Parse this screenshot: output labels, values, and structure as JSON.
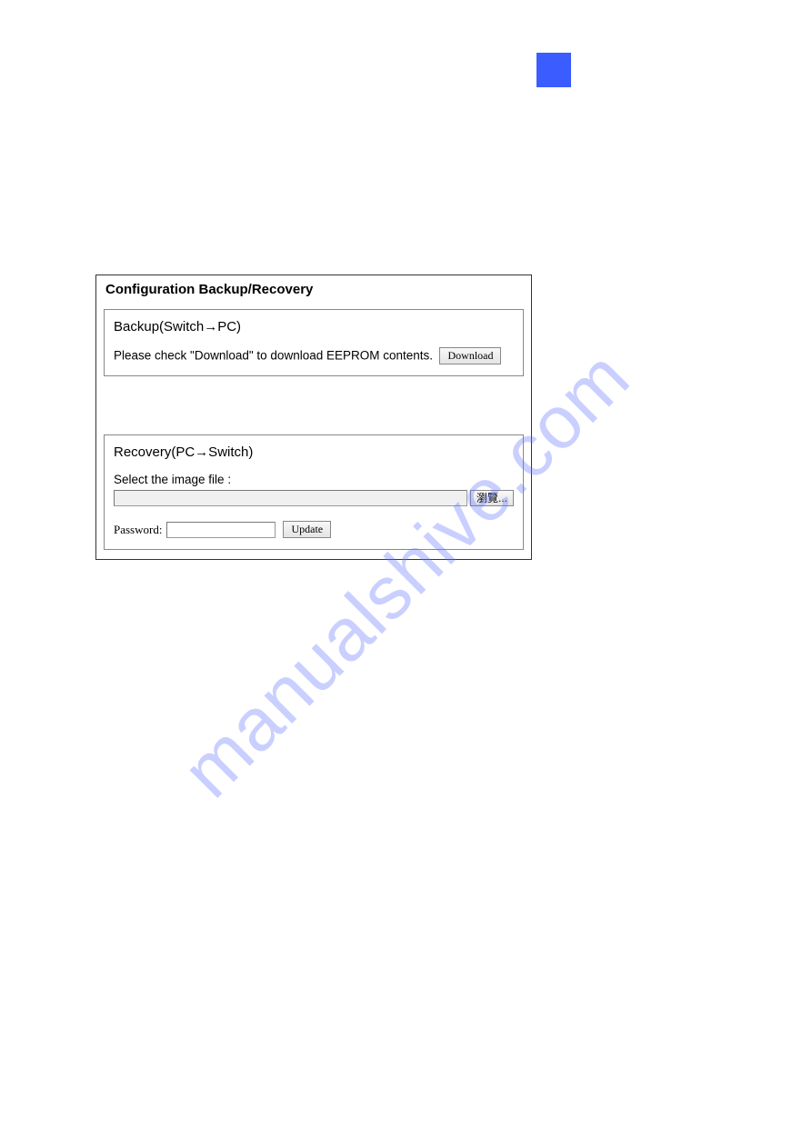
{
  "watermark": "manualshive.com",
  "panel": {
    "header": "Configuration Backup/Recovery",
    "backup": {
      "title": "Backup(Switch→PC)",
      "text": "Please check \"Download\" to download EEPROM contents.",
      "downloadLabel": "Download"
    },
    "recovery": {
      "title": "Recovery(PC→Switch)",
      "fileLabel": "Select the image file :",
      "browseLabel": "瀏覽...",
      "passwordLabel": "Password:",
      "passwordValue": "",
      "updateLabel": "Update"
    }
  }
}
